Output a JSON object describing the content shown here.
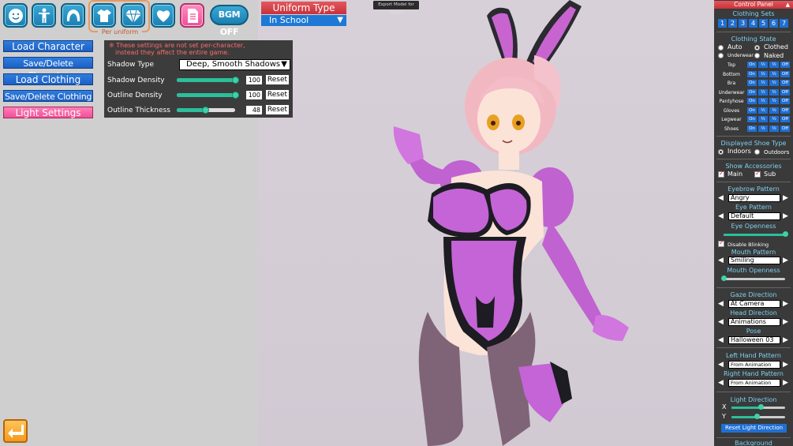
{
  "toolbar": {
    "icons": [
      {
        "name": "face-icon"
      },
      {
        "name": "body-icon"
      },
      {
        "name": "hair-icon"
      },
      {
        "name": "clothing-icon"
      },
      {
        "name": "accessory-icon"
      },
      {
        "name": "heart-icon"
      },
      {
        "name": "profile-icon"
      }
    ],
    "per_uniform_label": "Per uniform",
    "bgm_label": "BGM OFF",
    "uniform_type_label": "Uniform Type",
    "uniform_type_value": "In School",
    "export_label": "Export Model for KKBP"
  },
  "menu": {
    "items": [
      {
        "label": "Load Character",
        "active": false
      },
      {
        "label": "Save/Delete Character",
        "active": false
      },
      {
        "label": "Load Clothing",
        "active": false
      },
      {
        "label": "Save/Delete Clothing",
        "active": false
      },
      {
        "label": "Light Settings",
        "active": true
      }
    ]
  },
  "light_settings": {
    "warning_line1": "※ These settings are not set per-character,",
    "warning_line2": "instead they affect the entire game.",
    "shadow_type_label": "Shadow Type",
    "shadow_type_value": "Deep, Smooth Shadows",
    "reset_label": "Reset",
    "sliders": [
      {
        "label": "Shadow Density",
        "value": 100,
        "value_text": "100"
      },
      {
        "label": "Outline Density",
        "value": 100,
        "value_text": "100"
      },
      {
        "label": "Outline Thickness",
        "value": 48,
        "value_text": "48"
      }
    ]
  },
  "control_panel": {
    "title": "Control Panel",
    "clothing_sets_label": "Clothing Sets",
    "clothing_sets": [
      "1",
      "2",
      "3",
      "4",
      "5",
      "6",
      "7"
    ],
    "clothing_state_label": "Clothing State",
    "state_auto": "Auto",
    "state_clothed": "Clothed",
    "state_underwear": "Underwear",
    "state_naked": "Naked",
    "state_buttons": [
      "On",
      "½",
      "½",
      "Off"
    ],
    "clothing_parts": [
      "Top",
      "Bottom",
      "Bra",
      "Underwear",
      "Pantyhose",
      "Gloves",
      "Legwear",
      "Shoes"
    ],
    "shoe_type_label": "Displayed Shoe Type",
    "shoe_indoors": "Indoors",
    "shoe_outdoors": "Outdoors",
    "accessories_label": "Show Accessories",
    "acc_main": "Main",
    "acc_sub": "Sub",
    "eyebrow_label": "Eyebrow Pattern",
    "eyebrow_value": "Angry",
    "eye_label": "Eye Pattern",
    "eye_value": "Default",
    "eye_openness_label": "Eye Openness",
    "eye_openness": 1.0,
    "disable_blinking_label": "Disable Blinking",
    "mouth_label": "Mouth Pattern",
    "mouth_value": "Smiling",
    "mouth_openness_label": "Mouth Openness",
    "mouth_openness": 0.0,
    "gaze_label": "Gaze Direction",
    "gaze_value": "At Camera",
    "head_label": "Head Direction",
    "head_value": "Animations",
    "pose_label": "Pose",
    "pose_value": "Halloween 03",
    "left_hand_label": "Left Hand Pattern",
    "left_hand_value": "From Animation",
    "right_hand_label": "Right Hand Pattern",
    "right_hand_value": "From Animation",
    "light_dir_label": "Light Direction",
    "light_x_label": "X",
    "light_y_label": "Y",
    "light_x": 0.55,
    "light_y": 0.47,
    "reset_light_label": "Reset Light Direction",
    "background_label": "Background"
  },
  "colors": {
    "accent_blue": "#1f6fd3",
    "active_pink": "#f04f97",
    "title_red": "#c83239",
    "panel_dark": "#3a3a3a"
  }
}
